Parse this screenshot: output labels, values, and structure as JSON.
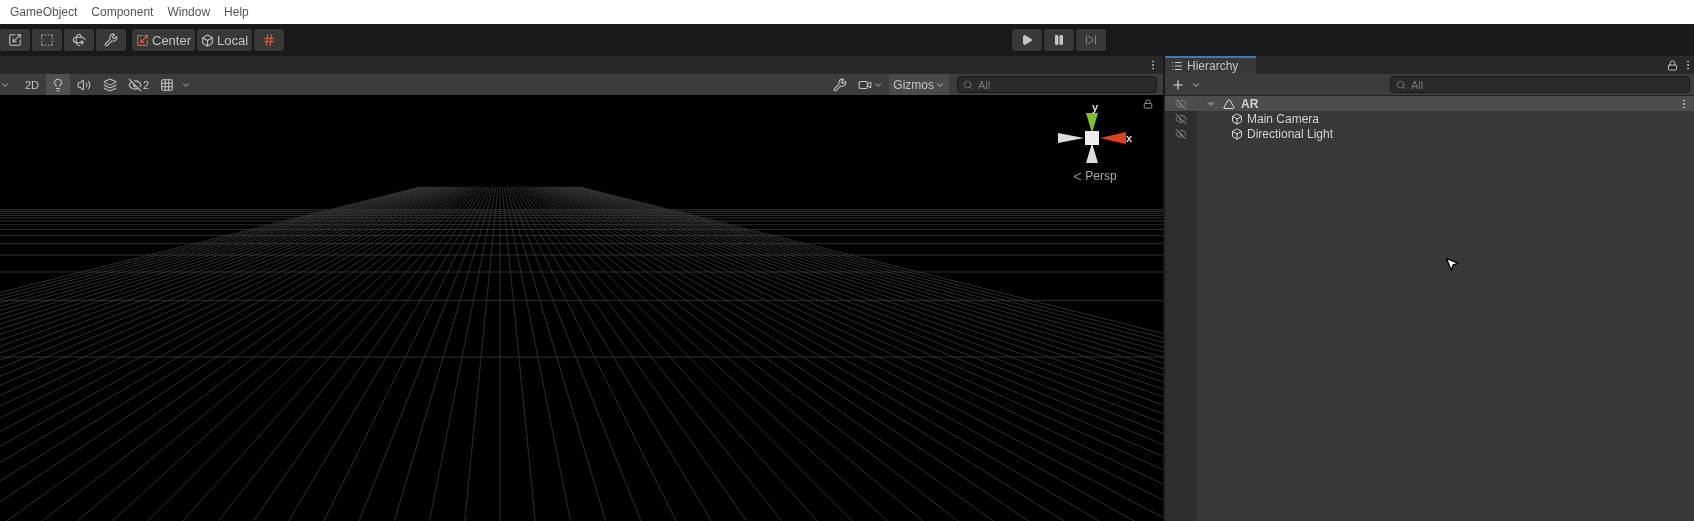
{
  "menu": [
    "GameObject",
    "Component",
    "Window",
    "Help"
  ],
  "toolbar": {
    "pivot": [
      {
        "label": "Center"
      },
      {
        "label": "Local"
      }
    ],
    "snap_on": false
  },
  "play_controls": {
    "playing": false,
    "paused": false
  },
  "scene": {
    "toggles": [
      {
        "kind": "text",
        "label": "2D",
        "on": false
      },
      {
        "kind": "lighting",
        "on": true
      },
      {
        "kind": "audio",
        "on": false
      },
      {
        "kind": "effects",
        "on": false
      },
      {
        "kind": "hidden",
        "label": "2",
        "on": false
      },
      {
        "kind": "grid",
        "on": false
      }
    ],
    "gizmos_label": "Gizmos",
    "search": {
      "placeholder": "All"
    },
    "axis": {
      "y": "y",
      "x": "x",
      "projection": "Persp"
    }
  },
  "hierarchy": {
    "tab": "Hierarchy",
    "search": {
      "placeholder": "All"
    },
    "tree": [
      {
        "name": "AR",
        "expanded": true,
        "selected": true,
        "children": [
          {
            "name": "Main Camera",
            "selected": false
          },
          {
            "name": "Directional Light",
            "selected": false
          }
        ]
      }
    ]
  }
}
